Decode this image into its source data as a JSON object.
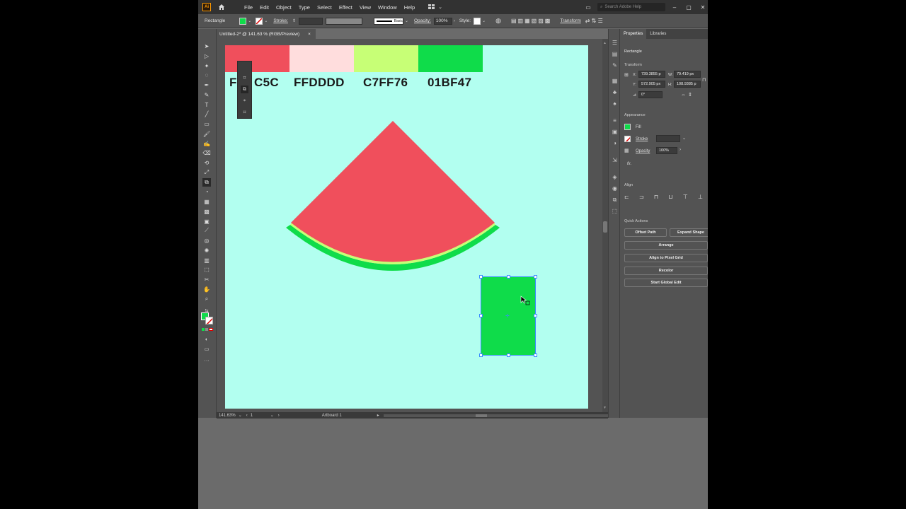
{
  "menubar": {
    "logo": "Ai",
    "items": [
      "File",
      "Edit",
      "Object",
      "Type",
      "Select",
      "Effect",
      "View",
      "Window",
      "Help"
    ],
    "search_placeholder": "Search Adobe Help"
  },
  "controlbar": {
    "object_type": "Rectangle",
    "stroke_label": "Stroke:",
    "stroke_style": "Basic",
    "opacity_label": "Opacity:",
    "opacity_value": "100%",
    "style_label": "Style:",
    "transform_label": "Transform",
    "fill_color": "#0fdc4a"
  },
  "document": {
    "tab_title": "Untitled-2* @ 141.63 % (RGB/Preview)",
    "tab_close": "×"
  },
  "artboard": {
    "background": "#b2fff0",
    "swatches": [
      {
        "color": "#f04f5c",
        "label": "F04F5C"
      },
      {
        "color": "#ffdddd",
        "label": "FFDDDD"
      },
      {
        "color": "#c7ff76",
        "label": "C7FF76"
      },
      {
        "color": "#01bf47",
        "label": "01BF47"
      }
    ],
    "visible_labels": [
      "F",
      "C5C",
      "FFDDDD",
      "C7FF76",
      "01BF47"
    ]
  },
  "status": {
    "zoom": "141.63%",
    "artboard_num": "1",
    "artboard_name": "Artboard 1"
  },
  "properties": {
    "tabs": [
      "Properties",
      "Libraries"
    ],
    "selection": "Rectangle",
    "transform_title": "Transform",
    "x_label": "X:",
    "x_value": "739.3855 p",
    "y_label": "Y:",
    "y_value": "572.905 px",
    "w_label": "W:",
    "w_value": "79.419 px",
    "h_label": "H:",
    "h_value": "108.9385 p",
    "angle_value": "0°",
    "appearance_title": "Appearance",
    "fill_label": "Fill",
    "stroke_label": "Stroke",
    "opacity_label": "Opacity",
    "opacity_value": "100%",
    "fx_label": "fx.",
    "align_title": "Align",
    "quick_actions_title": "Quick Actions",
    "qa_offset_path": "Offset Path",
    "qa_expand_shape": "Expand Shape",
    "qa_arrange": "Arrange",
    "qa_align_pixel": "Align to Pixel Grid",
    "qa_recolor": "Recolor",
    "qa_global_edit": "Start Global Edit"
  }
}
